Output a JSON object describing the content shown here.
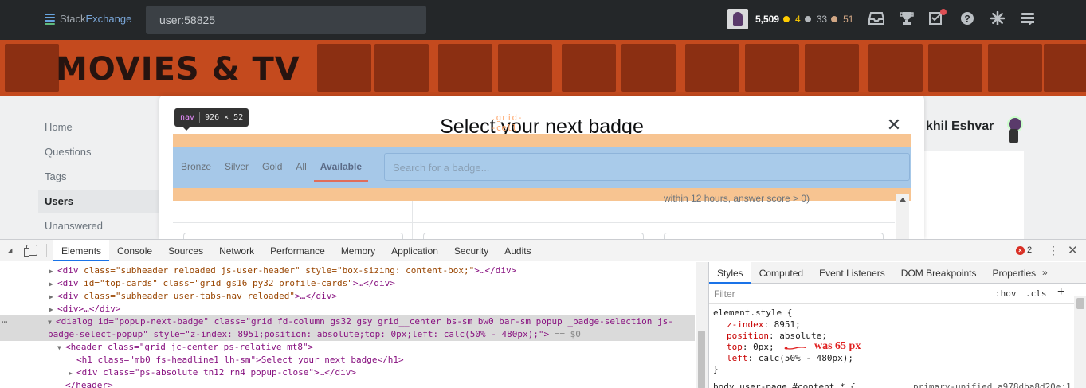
{
  "topbar": {
    "logo_text_a": "Stack",
    "logo_text_b": "Exchange",
    "search_value": "user:58825",
    "reputation": "5,509",
    "gold_count": "4",
    "silver_count": "33",
    "bronze_count": "51",
    "colors": {
      "bar": "#242729",
      "gold": "#ffcc01",
      "silver": "#b4b8bc",
      "bronze": "#d1a684"
    },
    "icons": [
      "inbox-icon",
      "achievements-icon",
      "review-icon",
      "help-icon",
      "site-switcher-icon",
      "stack-exchange-menu-icon"
    ]
  },
  "banner": {
    "title": "MOVIES & TV",
    "color": "#c44a1e"
  },
  "leftnav": {
    "items": [
      {
        "label": "Home"
      },
      {
        "label": "Questions"
      },
      {
        "label": "Tags"
      },
      {
        "label": "Users"
      },
      {
        "label": "Unanswered"
      }
    ]
  },
  "profile": {
    "name_fragment": "khil Eshvar"
  },
  "modal": {
    "title": "Select your next badge",
    "filters": [
      "Bronze",
      "Silver",
      "Gold",
      "All",
      "Available"
    ],
    "selected_filter": "Available",
    "search_placeholder": "Search for a badge...",
    "partial_text": "within 12 hours, answer score > 0)"
  },
  "inspect_tooltip": {
    "tag": "nav",
    "class": ".grid--cell",
    "dims": "926 × 52"
  },
  "devtools": {
    "tabs": [
      "Elements",
      "Console",
      "Sources",
      "Network",
      "Performance",
      "Memory",
      "Application",
      "Security",
      "Audits"
    ],
    "active_tab": "Elements",
    "error_count": "2",
    "error_glyph": "×",
    "elements_lines": [
      {
        "text_tag": "<div ",
        "attrs": "class=\"subheader reloaded js-user-header\" style=\"box-sizing: content-box;\"",
        "tail": ">…</div>"
      },
      {
        "text_tag": "<div ",
        "attrs": "id=\"top-cards\" class=\"grid gs16 py32 profile-cards\"",
        "tail": ">…</div>"
      },
      {
        "text_tag": "<div ",
        "attrs": "class=\"subheader user-tabs-nav reloaded\"",
        "tail": ">…</div>"
      },
      {
        "text_tag": "<div>",
        "attrs": "",
        "tail": "…</div>"
      }
    ],
    "selected_line_1": "<dialog id=\"popup-next-badge\" class=\"grid fd-column gs32 gsy grid__center bs-sm bw0 bar-sm popup _badge-selection js-",
    "selected_line_2": "badge-select-popup\" style=\"z-index: 8951;position: absolute;top: 0px;left: calc(50% - 480px);\">",
    "selected_suffix": " == $0",
    "header_line": "<header class=\"grid jc-center ps-relative mt8\">",
    "h1_line": "<h1 class=\"mb0 fs-headline1 lh-sm\">Select your next badge</h1>",
    "close_div_line": "<div class=\"ps-absolute tn12 rn4 popup-close\">…</div>",
    "header_close": "</header>",
    "styles_tabs": [
      "Styles",
      "Computed",
      "Event Listeners",
      "DOM Breakpoints",
      "Properties"
    ],
    "styles_more": "»",
    "filter_placeholder": "Filter",
    "hov": ":hov",
    "cls": ".cls",
    "plus": "+",
    "element_style_open": "element.style {",
    "props": [
      {
        "name": "z-index",
        "value": "8951;"
      },
      {
        "name": "position",
        "value": "absolute;"
      },
      {
        "name": "top",
        "value": "0px;"
      },
      {
        "name": "left",
        "value": "calc(50% - 480px);"
      }
    ],
    "element_style_close": "}",
    "annotation": "was 65 px",
    "next_rule": "body.user-page #content * {",
    "next_rule_source": "primary-unified…a978dba8d20e:1"
  }
}
